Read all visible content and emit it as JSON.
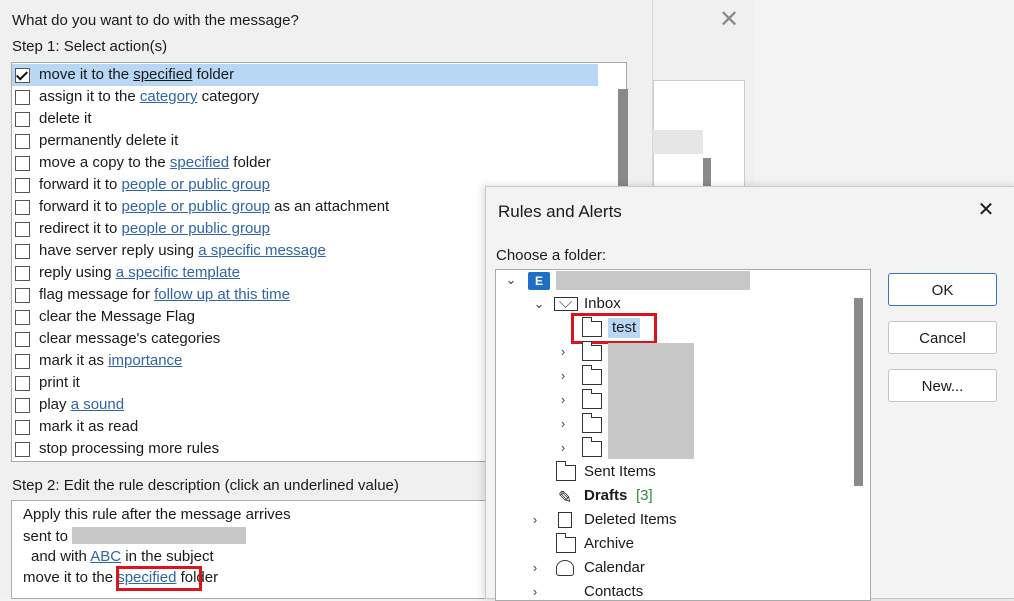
{
  "wizard": {
    "title": "What do you want to do with the message?",
    "step1": "Step 1: Select action(s)",
    "actions": [
      {
        "pre": "move it to the ",
        "link": "specified",
        "post": " folder",
        "checked": true,
        "selected": true
      },
      {
        "pre": "assign it to the ",
        "link": "category",
        "post": " category",
        "checked": false
      },
      {
        "pre": "delete it",
        "link": "",
        "post": "",
        "checked": false
      },
      {
        "pre": "permanently delete it",
        "link": "",
        "post": "",
        "checked": false
      },
      {
        "pre": "move a copy to the ",
        "link": "specified",
        "post": " folder",
        "checked": false
      },
      {
        "pre": "forward it to ",
        "link": "people or public group",
        "post": "",
        "checked": false
      },
      {
        "pre": "forward it to ",
        "link": "people or public group",
        "post": " as an attachment",
        "checked": false
      },
      {
        "pre": "redirect it to ",
        "link": "people or public group",
        "post": "",
        "checked": false
      },
      {
        "pre": "have server reply using ",
        "link": "a specific message",
        "post": "",
        "checked": false
      },
      {
        "pre": "reply using ",
        "link": "a specific template",
        "post": "",
        "checked": false
      },
      {
        "pre": "flag message for ",
        "link": "follow up at this time",
        "post": "",
        "checked": false
      },
      {
        "pre": "clear the Message Flag",
        "link": "",
        "post": "",
        "checked": false
      },
      {
        "pre": "clear message's categories",
        "link": "",
        "post": "",
        "checked": false
      },
      {
        "pre": "mark it as ",
        "link": "importance",
        "post": "",
        "checked": false
      },
      {
        "pre": "print it",
        "link": "",
        "post": "",
        "checked": false
      },
      {
        "pre": "play ",
        "link": "a sound",
        "post": "",
        "checked": false
      },
      {
        "pre": "mark it as read",
        "link": "",
        "post": "",
        "checked": false
      },
      {
        "pre": "stop processing more rules",
        "link": "",
        "post": "",
        "checked": false
      }
    ],
    "step2": "Step 2: Edit the rule description (click an underlined value)",
    "description": {
      "line1": "Apply this rule after the message arrives",
      "line2_pre": "sent to ",
      "line3_pre": "and with ",
      "line3_link": "ABC",
      "line3_post": " in the subject",
      "line4_pre": "move it to the ",
      "line4_link": "specified",
      "line4_post": " folder"
    }
  },
  "dialog": {
    "title": "Rules and Alerts",
    "close_glyph": "✕",
    "prompt": "Choose a folder:",
    "tree": {
      "account_badge": "E",
      "inbox": "Inbox",
      "test": "test",
      "sent": "Sent Items",
      "drafts": "Drafts",
      "drafts_count": "[3]",
      "deleted": "Deleted Items",
      "archive": "Archive",
      "calendar": "Calendar",
      "contacts": "Contacts"
    },
    "buttons": {
      "ok": "OK",
      "cancel": "Cancel",
      "new": "New..."
    }
  },
  "colors": {
    "link": "#2f64a8",
    "highlight": "#b8d7f4",
    "annotation": "#d9141d"
  }
}
